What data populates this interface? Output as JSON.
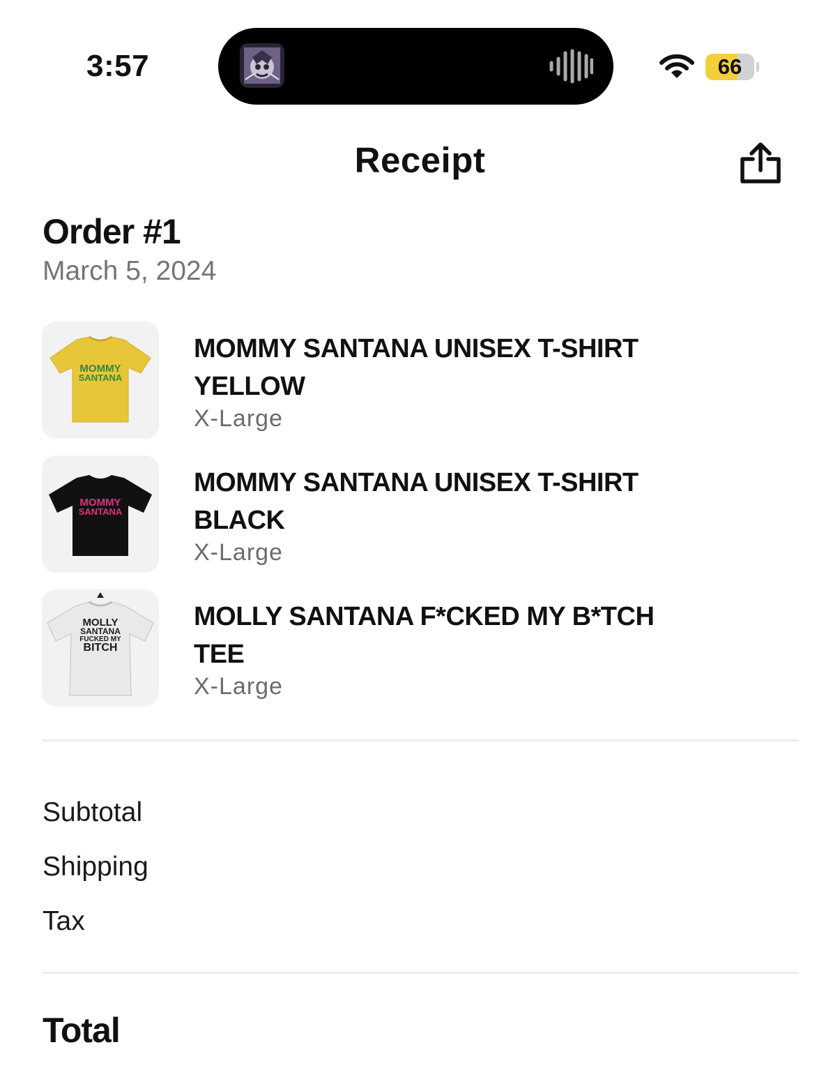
{
  "status_bar": {
    "time": "3:57",
    "battery_level": "66",
    "battery_fraction": 0.66,
    "icons": [
      "album-art-icon",
      "audio-waveform-icon",
      "wifi-icon",
      "battery-icon"
    ]
  },
  "nav": {
    "title": "Receipt",
    "share_icon": "share-icon"
  },
  "order": {
    "number": "Order #1",
    "date": "March 5, 2024"
  },
  "items": [
    {
      "name": "MOMMY SANTANA UNISEX T-SHIRT YELLOW",
      "size": "X-Large",
      "shirt_color": "#e8c63a",
      "print_lines": [
        "MOMMY",
        "SANTANA"
      ],
      "print_color": "#2e8b3a"
    },
    {
      "name": "MOMMY SANTANA UNISEX T-SHIRT BLACK",
      "size": "X-Large",
      "shirt_color": "#111111",
      "print_lines": [
        "MOMMY",
        "SANTANA"
      ],
      "print_color": "#e0307f"
    },
    {
      "name": "MOLLY SANTANA F*CKED MY B*TCH TEE",
      "size": "X-Large",
      "shirt_color": "#e9e9e9",
      "print_lines": [
        "MOLLY",
        "SANTANA",
        "FUCKED MY",
        "BITCH"
      ],
      "print_color": "#1a1a1a"
    }
  ],
  "summary": {
    "subtotal_label": "Subtotal",
    "shipping_label": "Shipping",
    "tax_label": "Tax",
    "total_label": "Total"
  },
  "colors": {
    "accent_battery": "#f4cf3c",
    "secondary_text": "#757575",
    "divider": "#ececec",
    "thumb_background": "#f2f2f2"
  }
}
